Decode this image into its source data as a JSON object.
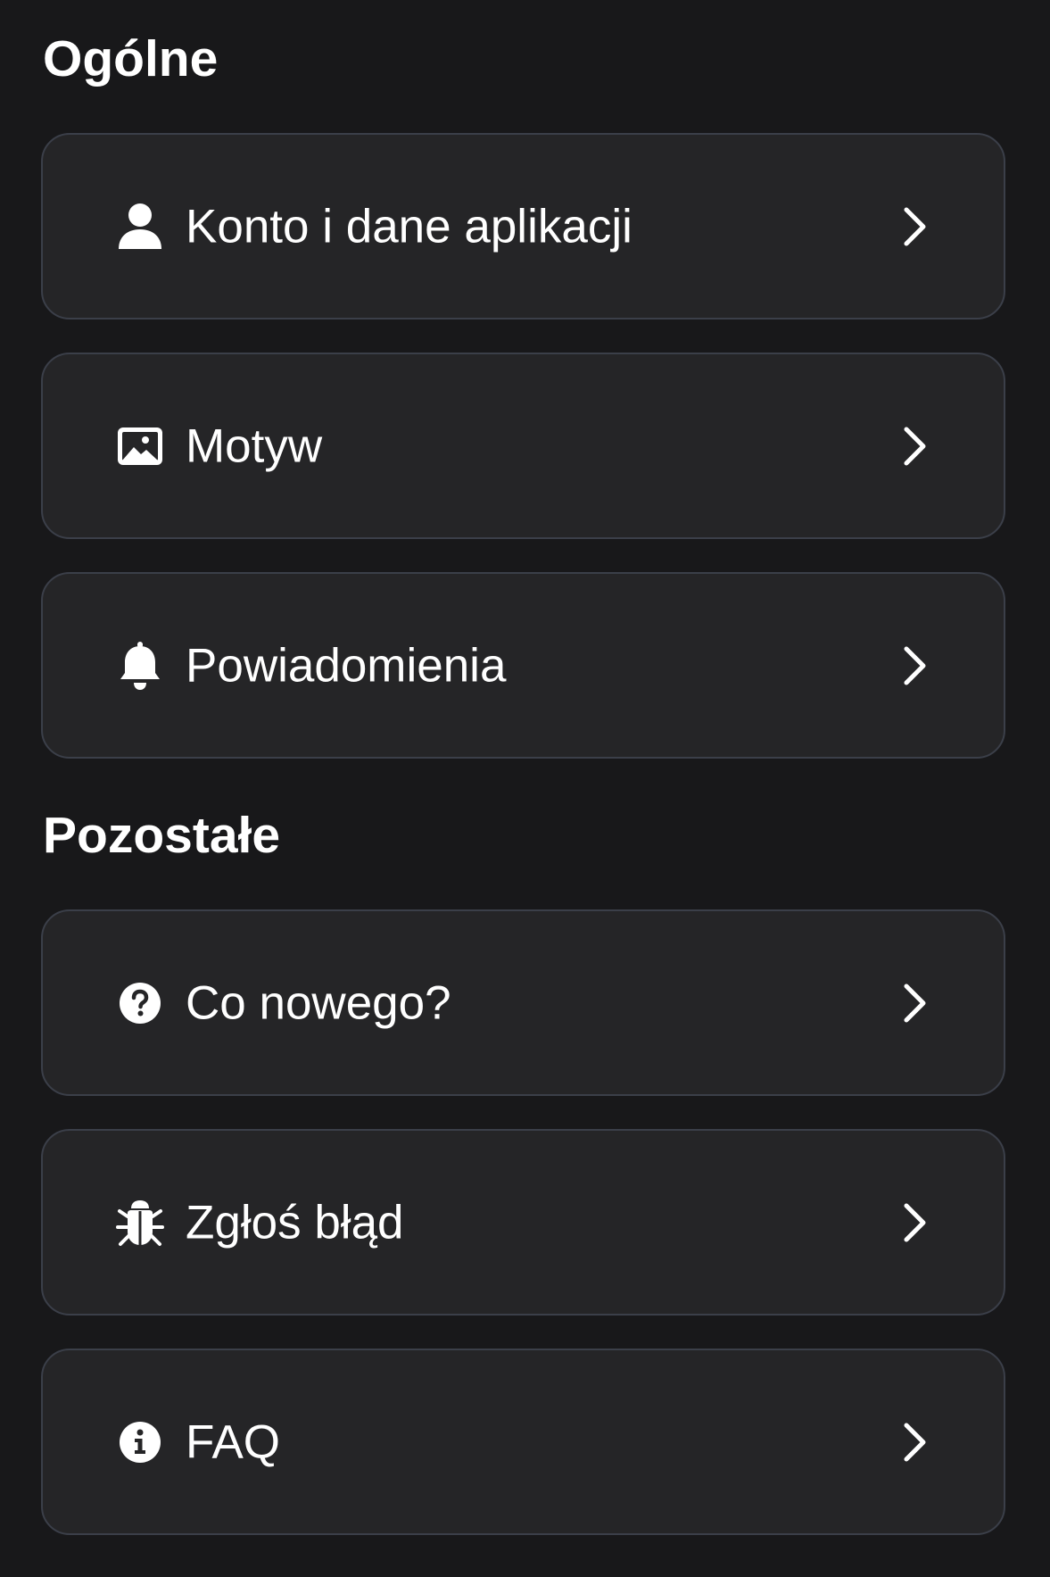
{
  "sections": [
    {
      "title": "Ogólne",
      "items": [
        {
          "label": "Konto i dane aplikacji",
          "icon": "user-icon"
        },
        {
          "label": "Motyw",
          "icon": "image-icon"
        },
        {
          "label": "Powiadomienia",
          "icon": "bell-icon"
        }
      ]
    },
    {
      "title": "Pozostałe",
      "items": [
        {
          "label": "Co nowego?",
          "icon": "question-circle-icon"
        },
        {
          "label": "Zgłoś błąd",
          "icon": "bug-icon"
        },
        {
          "label": "FAQ",
          "icon": "info-circle-icon"
        }
      ]
    }
  ],
  "colors": {
    "background": "#18181a",
    "card": "#252527",
    "card_border": "#3b3f49",
    "text": "#ffffff"
  }
}
